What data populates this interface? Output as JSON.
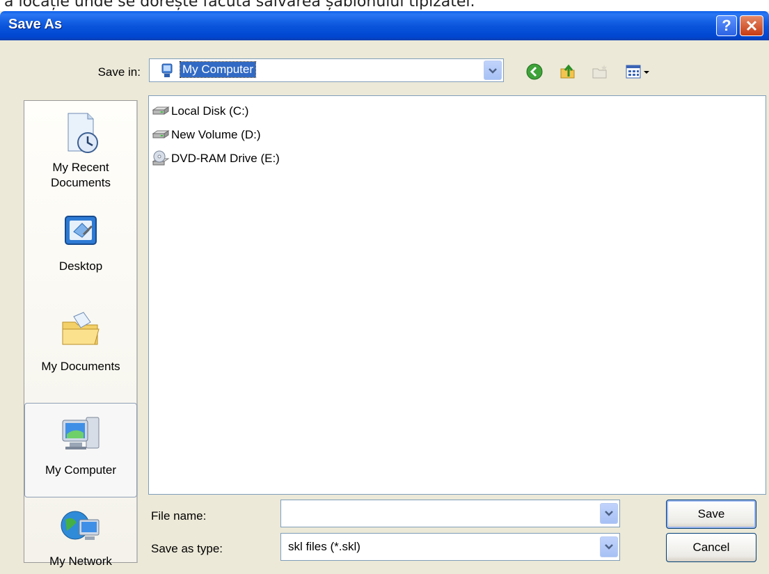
{
  "caption": "a locație unde se dorește facută salvarea șablonului tipizatei.",
  "window": {
    "title": "Save As",
    "help_symbol": "?"
  },
  "toolbar": {
    "save_in_label": "Save in:",
    "save_in_value": "My Computer",
    "tools": [
      "back-icon",
      "up-folder-icon",
      "new-folder-icon",
      "views-menu-icon"
    ]
  },
  "places": [
    {
      "label": "My Recent Documents",
      "icon": "recent-documents-icon"
    },
    {
      "label": "Desktop",
      "icon": "desktop-icon"
    },
    {
      "label": "My Documents",
      "icon": "my-documents-icon"
    },
    {
      "label": "My Computer",
      "icon": "my-computer-icon",
      "selected": true
    },
    {
      "label": "My Network",
      "icon": "my-network-icon"
    }
  ],
  "drives": [
    {
      "label": "Local Disk (C:)",
      "icon": "hard-disk-icon"
    },
    {
      "label": "New Volume (D:)",
      "icon": "hard-disk-icon"
    },
    {
      "label": "DVD-RAM Drive (E:)",
      "icon": "dvd-drive-icon"
    }
  ],
  "form": {
    "file_name_label": "File name:",
    "file_name_value": "",
    "save_as_type_label": "Save as type:",
    "save_as_type_value": "skl files (*.skl)"
  },
  "buttons": {
    "save": "Save",
    "cancel": "Cancel"
  },
  "colors": {
    "titlebar": "#0a55dc",
    "selection": "#316ac5",
    "dialog_bg": "#ece9d8"
  }
}
